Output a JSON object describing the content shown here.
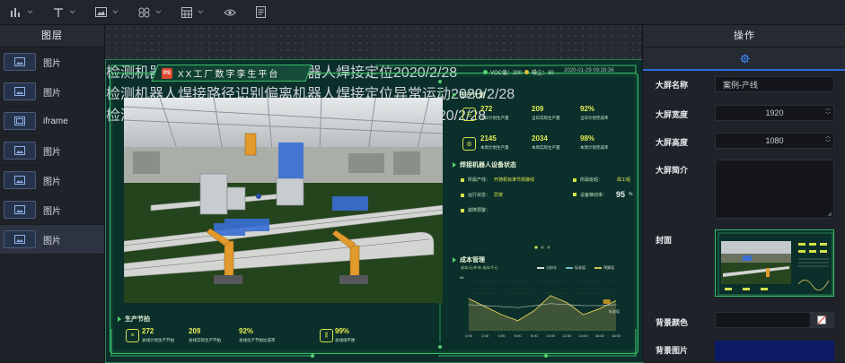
{
  "toolbar": {
    "items": [
      {
        "icon": "bar-chart-icon"
      },
      {
        "icon": "text-icon"
      },
      {
        "icon": "image-icon"
      },
      {
        "icon": "components-icon"
      },
      {
        "icon": "table-icon"
      },
      {
        "icon": "eye-icon"
      },
      {
        "icon": "document-icon"
      }
    ]
  },
  "left_panel": {
    "title": "图层",
    "layers": [
      {
        "label": "图片",
        "icon": "image-icon"
      },
      {
        "label": "图片",
        "icon": "image-icon"
      },
      {
        "label": "iframe",
        "icon": "iframe-icon"
      },
      {
        "label": "图片",
        "icon": "image-icon"
      },
      {
        "label": "图片",
        "icon": "image-icon"
      },
      {
        "label": "图片",
        "icon": "image-icon"
      },
      {
        "label": "图片",
        "icon": "image-icon",
        "active": true
      }
    ]
  },
  "screen": {
    "title": "XX工厂数字孪生平台",
    "logo_text": "PS",
    "voc_label": "VOC值：200",
    "noise_label": "噪尘：30",
    "datetime": "2020-01-29 09:28:36",
    "production_plan": {
      "title": "生产计划",
      "kpis": [
        {
          "value": "272",
          "label": "当日计划生产量"
        },
        {
          "value": "209",
          "label": "当日实际生产量"
        },
        {
          "value": "92%",
          "label": "当日计划完成率"
        },
        {
          "value": "2145",
          "label": "本周计划生产量"
        },
        {
          "value": "2034",
          "label": "本周实际生产量"
        },
        {
          "value": "98%",
          "label": "本周计划完成率"
        }
      ]
    },
    "robot_status": {
      "title": "焊接机器人设备状态",
      "line_label": "所属产线：",
      "line_value": "开骑机标准节焊接线",
      "area_label": "所属班组：",
      "area_value": "焊工组",
      "run_label": "运行状态：",
      "run_value": "异常",
      "util_label": "设备稼动率：",
      "util_value": "95",
      "util_unit": "%",
      "alarm_label": "故障预警：",
      "alarms": [
        {
          "text": "检测机器人焊接路径识别偏离机器人焊接定位",
          "date": "2020/2/28"
        },
        {
          "text": "检测机器人焊接路径识别偏离机器人焊接定位异常运动",
          "date": "2020/2/28"
        },
        {
          "text": "检测机器人焊接质量识别偏离机器人焊接定位异常",
          "date": "2020/2/28"
        }
      ]
    },
    "cost": {
      "title": "成本管理",
      "subtitle": "成本/元/件/年 成本/千元",
      "legend": [
        "当前年",
        "标准值",
        "预算值"
      ],
      "y_label": "ML",
      "x_ticks": [
        "0:00",
        "2:00",
        "4:00",
        "6:00",
        "8:00",
        "10:00",
        "12:00",
        "14:00",
        "16:00",
        "18:00"
      ],
      "marker_label": "标准值"
    },
    "production_rhythm": {
      "title": "生产节拍",
      "kpis": [
        {
          "value": "272",
          "label": "总线计划生产节拍"
        },
        {
          "value": "209",
          "label": "总线实际生产节拍"
        },
        {
          "value": "92%",
          "label": "总线生产节拍达成率"
        },
        {
          "value": "99%",
          "label": "总线线平衡"
        }
      ]
    }
  },
  "chart_data": {
    "type": "line",
    "x": [
      "0:00",
      "2:00",
      "4:00",
      "6:00",
      "8:00",
      "10:00",
      "12:00",
      "14:00",
      "16:00",
      "18:00"
    ],
    "series": [
      {
        "name": "当前年",
        "values": [
          52,
          44,
          36,
          30,
          40,
          55,
          48,
          36,
          42,
          50
        ]
      },
      {
        "name": "标准值",
        "values": [
          46,
          45,
          44,
          43,
          45,
          47,
          46,
          45,
          45,
          46
        ]
      }
    ],
    "ylabel": "ML",
    "colors": [
      "#d7c45a",
      "#d6d9de"
    ]
  },
  "right_panel": {
    "title": "操作",
    "settings_icon": "gear-icon",
    "screen_name_label": "大屏名称",
    "screen_name_value": "案例-产线",
    "width_label": "大屏宽度",
    "width_value": "1920",
    "height_label": "大屏高度",
    "height_value": "1080",
    "desc_label": "大屏简介",
    "cover_label": "封面",
    "bg_color_label": "背景颜色",
    "bg_image_label": "背景图片"
  }
}
